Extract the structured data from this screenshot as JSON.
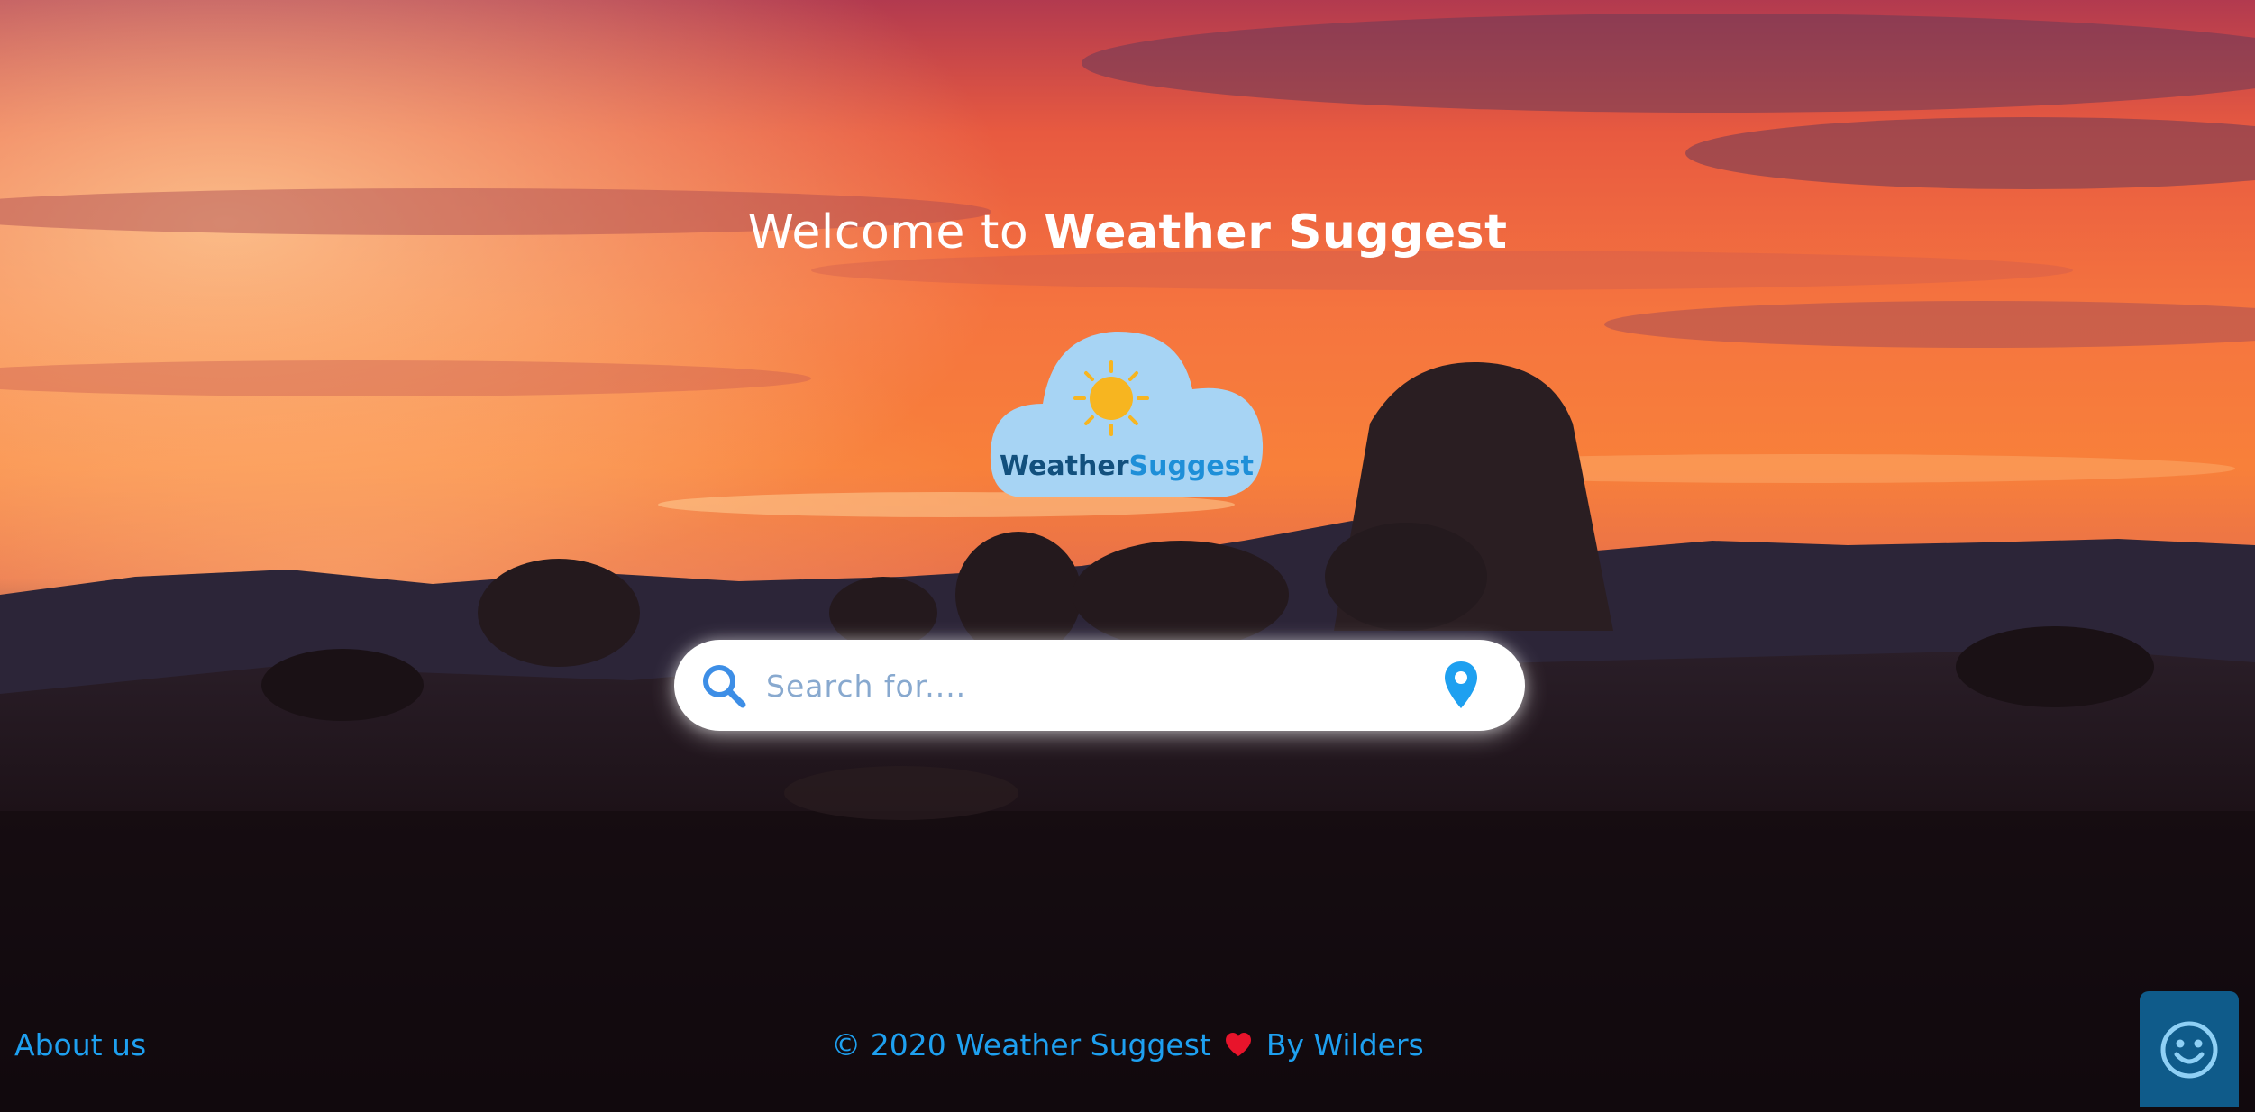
{
  "header": {
    "welcome_prefix": "Welcome to",
    "welcome_brand": "Weather Suggest"
  },
  "logo": {
    "brand_part1": "Weather",
    "brand_part2": "Suggest",
    "icon": "sun-cloud-logo"
  },
  "search": {
    "placeholder": "Search for....",
    "value": "",
    "icon": "search-icon",
    "location_icon": "location-pin-icon"
  },
  "footer": {
    "about_label": "About us",
    "copyright_prefix": "© 2020 Weather Suggest",
    "copyright_suffix": "By Wilders",
    "heart_icon": "heart-icon"
  },
  "chat_widget": {
    "icon": "smiley-icon"
  },
  "colors": {
    "accent": "#1ea0f0",
    "logo_cloud": "#a7d4f4",
    "logo_text_dark": "#12507d",
    "logo_text_light": "#1e8fd8",
    "sun": "#f7b520",
    "heart": "#e8142b",
    "chat_bg": "#0f5b8a"
  }
}
